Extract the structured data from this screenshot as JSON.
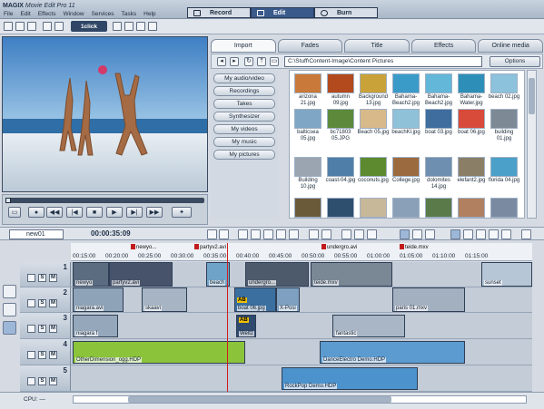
{
  "app": {
    "brand": "MAGIX",
    "product": "Movie Edit Pro 11"
  },
  "menu": [
    "File",
    "Edit",
    "Effects",
    "Window",
    "Services",
    "Tasks",
    "Help"
  ],
  "modes": [
    {
      "label": "Record"
    },
    {
      "label": "Edit",
      "active": true
    },
    {
      "label": "Burn"
    }
  ],
  "toolbar": {
    "oneclick_label": "1click"
  },
  "media_tabs": [
    "Import",
    "Fades",
    "Title",
    "Effects",
    "Online media"
  ],
  "media_path": "C:\\Stuff\\Content-Image\\Content Pictures",
  "options_label": "Options",
  "media_categories": [
    "My audio/video",
    "Recordings",
    "Takes",
    "Synthesizer",
    "My videos",
    "My music",
    "My pictures"
  ],
  "thumbnails": [
    {
      "name": "arizona 21.jpg",
      "color": "#c97a3a"
    },
    {
      "name": "autumn 09.jpg",
      "color": "#b34a1d"
    },
    {
      "name": "Background 13.jpg",
      "color": "#c9a23a"
    },
    {
      "name": "Bahama-Beach2.jpg",
      "color": "#3a9bc9"
    },
    {
      "name": "Bahama-Beach2.jpg",
      "color": "#63b7d9"
    },
    {
      "name": "Bahama-Water.jpg",
      "color": "#2d8fb8"
    },
    {
      "name": "beach 02.jpg",
      "color": "#8cc2dc"
    },
    {
      "name": "balticsea 05.jpg",
      "color": "#7fa6c4"
    },
    {
      "name": "bc71803 05.JPG",
      "color": "#5c8a3a"
    },
    {
      "name": "Beach 05.jpg",
      "color": "#d7b98a"
    },
    {
      "name": "beachKl.jpg",
      "color": "#8fc1d8"
    },
    {
      "name": "boat 03.jpg",
      "color": "#3f6d9e"
    },
    {
      "name": "boat 06.jpg",
      "color": "#d84a3a"
    },
    {
      "name": "building 01.jpg",
      "color": "#7d8a96"
    },
    {
      "name": "Building 10.jpg",
      "color": "#9aa5b1"
    },
    {
      "name": "coast-04.jpg",
      "color": "#4f7fa8"
    },
    {
      "name": "coconuts.jpg",
      "color": "#5e8a2f"
    },
    {
      "name": "College.jpg",
      "color": "#9b6a3f"
    },
    {
      "name": "dolomites 14.jpg",
      "color": "#6f8fb0"
    },
    {
      "name": "elefant2.jpg",
      "color": "#8a7f66"
    },
    {
      "name": "florida 04.jpg",
      "color": "#4aa0c8"
    },
    {
      "name": "",
      "color": "#6b5a3a"
    },
    {
      "name": "",
      "color": "#2f4f6f"
    },
    {
      "name": "",
      "color": "#c8b89a"
    },
    {
      "name": "",
      "color": "#8aa0b8"
    },
    {
      "name": "",
      "color": "#5a7a4a"
    },
    {
      "name": "",
      "color": "#b08060"
    },
    {
      "name": "",
      "color": "#7a8aa0"
    }
  ],
  "arranger": {
    "project": "new01",
    "timecode": "00:00:35:09"
  },
  "ruler": {
    "ticks": [
      "00:15:00",
      "00:20:00",
      "00:25:00",
      "00:30:00",
      "00:35:00",
      "00:40:00",
      "00:45:00",
      "00:50:00",
      "00:55:00",
      "01:00:00",
      "01:05:00",
      "01:10:00",
      "01:15:00"
    ],
    "markers": [
      "newyo...",
      "partyv2.avi",
      "underg...",
      "undergro.avi",
      "teide.mxv"
    ]
  },
  "tracks": [
    {
      "num": "1"
    },
    {
      "num": "2"
    },
    {
      "num": "3"
    },
    {
      "num": "4"
    },
    {
      "num": "5"
    }
  ],
  "clips": [
    {
      "label": "newyo",
      "color": "#5c6c80"
    },
    {
      "label": "partyv2.avi",
      "color": "#46536a"
    },
    {
      "label": "beach",
      "color": "#6fa4c8"
    },
    {
      "label": "undergro...",
      "color": "#4d5a6c"
    },
    {
      "label": "teide.mxv",
      "color": "#7a8896"
    },
    {
      "label": "sunset",
      "color": "#b6c6d6"
    },
    {
      "label": "niagara.avi",
      "color": "#8fa3b8"
    },
    {
      "label": "skaavi",
      "color": "#a6b4c4"
    },
    {
      "label": "boat 06.jpg",
      "color": "#3a6fa0"
    },
    {
      "label": "X-Posi",
      "color": "#7fa0c0"
    },
    {
      "label": "paris 01.mxv",
      "color": "#a3b0c0"
    },
    {
      "label": "niagara f",
      "color": "#95a7bb"
    },
    {
      "label": "Weltz",
      "color": "#2f4a6e"
    },
    {
      "label": "fantastic",
      "color": "#a8b6c6"
    },
    {
      "label": "OtherDimension_ogg.HDP",
      "color": "#8bc43a"
    },
    {
      "label": "DanceElectro Demo.HDP",
      "color": "#5b9bd0"
    },
    {
      "label": "RockPop Demo.HDP",
      "color": "#4c92cc"
    }
  ],
  "badges": {
    "a": "AB",
    "b": "AB"
  },
  "track_buttons": {
    "solo": "S",
    "mute": "M"
  },
  "status": {
    "cpu": "CPU: —"
  }
}
